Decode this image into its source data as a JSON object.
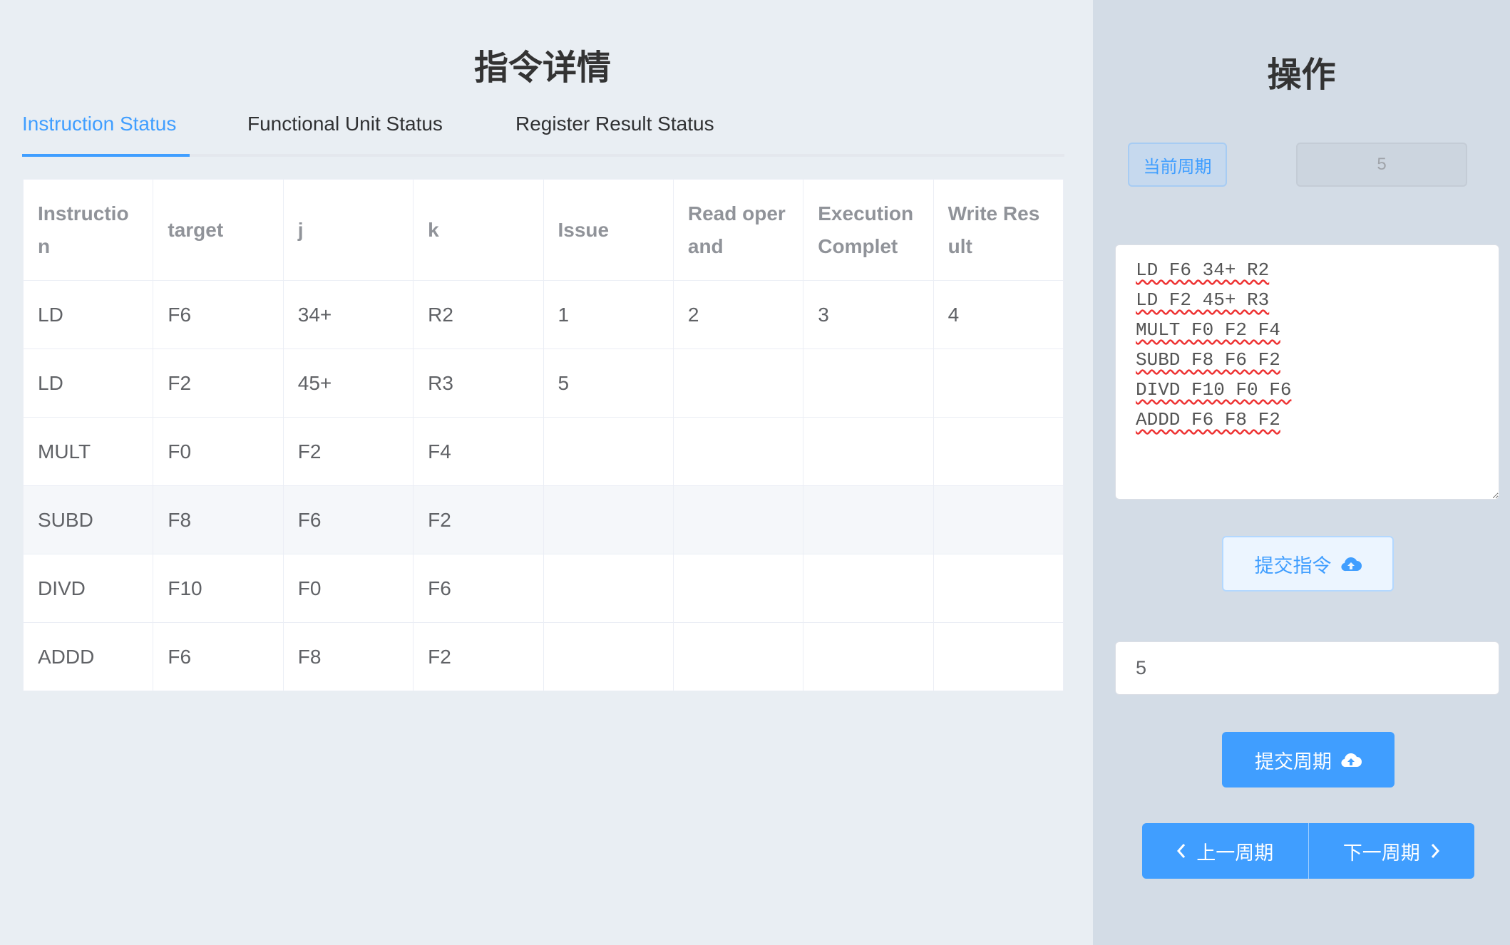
{
  "left": {
    "title": "指令详情",
    "tabs": [
      {
        "label": "Instruction Status",
        "active": true
      },
      {
        "label": "Functional Unit Status"
      },
      {
        "label": "Register Result Status"
      }
    ],
    "table": {
      "headers": [
        "Instruction",
        "target",
        "j",
        "k",
        "Issue",
        "Read operand",
        "Execution Complet",
        "Write Result"
      ],
      "rows": [
        [
          "LD",
          "F6",
          "34+",
          "R2",
          "1",
          "2",
          "3",
          "4"
        ],
        [
          "LD",
          "F2",
          "45+",
          "R3",
          "5",
          "",
          "",
          ""
        ],
        [
          "MULT",
          "F0",
          "F2",
          "F4",
          "",
          "",
          "",
          ""
        ],
        [
          "SUBD",
          "F8",
          "F6",
          "F2",
          "",
          "",
          "",
          ""
        ],
        [
          "DIVD",
          "F10",
          "F0",
          "F6",
          "",
          "",
          "",
          ""
        ],
        [
          "ADDD",
          "F6",
          "F8",
          "F2",
          "",
          "",
          "",
          ""
        ]
      ]
    }
  },
  "right": {
    "title": "操作",
    "current_cycle_label": "当前周期",
    "current_cycle_value": "5",
    "instructions": "LD F6 34+ R2\nLD F2 45+ R3\nMULT F0 F2 F4\nSUBD F8 F6 F2\nDIVD F10 F0 F6\nADDD F6 F8 F2",
    "submit_instructions": "提交指令",
    "cycle_input": "5",
    "submit_cycle": "提交周期",
    "prev_cycle": "上一周期",
    "next_cycle": "下一周期",
    "icons": {
      "upload": "cloud-upload-icon",
      "prev": "chevron-left-icon",
      "next": "chevron-right-icon"
    }
  },
  "colors": {
    "accent": "#409eff"
  }
}
